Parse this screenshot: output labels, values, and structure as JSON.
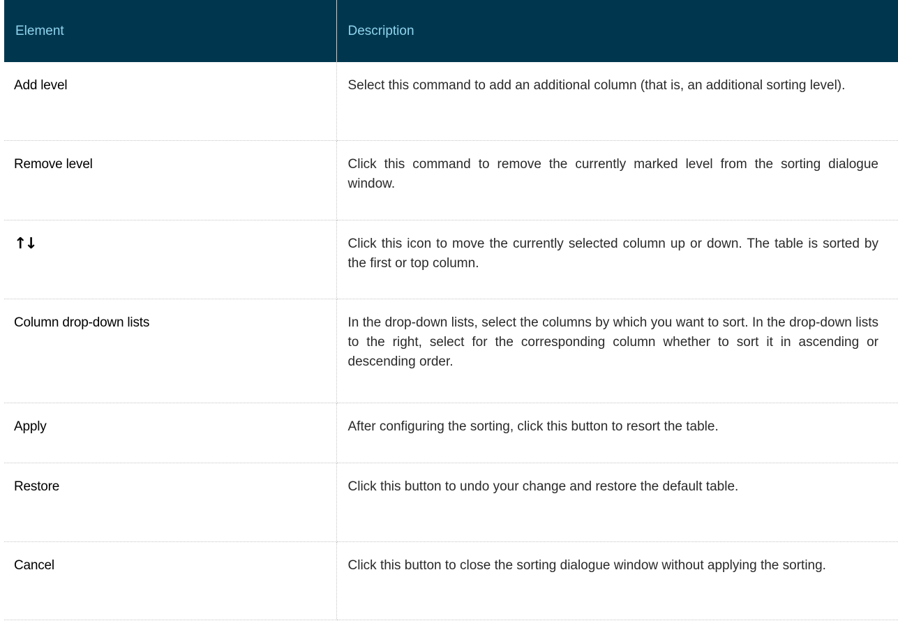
{
  "header": {
    "element": "Element",
    "description": "Description"
  },
  "rows": [
    {
      "element": "Add level",
      "description": "Select this command to add an additional column (that is, an additional sorting level)."
    },
    {
      "element": "Remove level",
      "description": "Click this command to remove the currently marked level from the sorting dialogue window."
    },
    {
      "icon": "up-down-arrows-icon",
      "description": "Click this icon to move the currently selected column up or down. The table is sorted by the first or top column."
    },
    {
      "element": "Column drop-down lists",
      "description": "In the drop-down lists, select the columns by which you want to sort. In the drop-down lists to the right, select for the corresponding column whether to sort it in ascending or descending order."
    },
    {
      "element": "Apply",
      "description": "After configuring the sorting, click this button to resort the table."
    },
    {
      "element": "Restore",
      "description": "Click this button to undo your change and restore the default table."
    },
    {
      "element": "Cancel",
      "description": "Click this button to close the sorting dialogue window without applying the sorting."
    }
  ],
  "colors": {
    "header_bg": "#00374f",
    "header_text": "#8fd3ec"
  }
}
